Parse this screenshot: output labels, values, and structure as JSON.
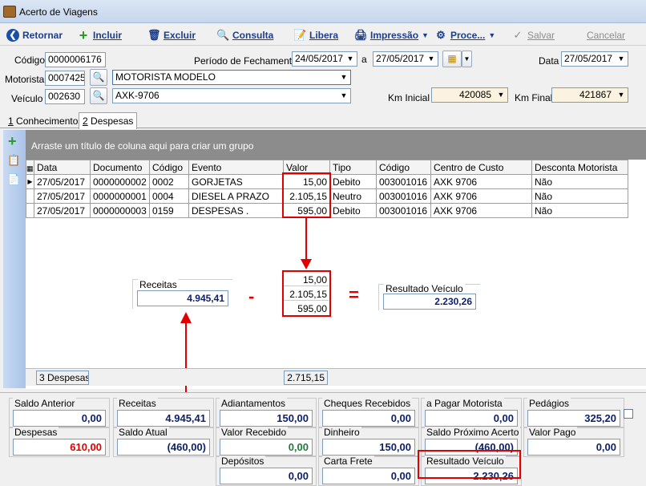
{
  "window": {
    "title": "Acerto de Viagens"
  },
  "toolbar": {
    "retornar": "Retornar",
    "incluir": "Incluir",
    "excluir": "Excluir",
    "consulta": "Consulta",
    "libera": "Libera",
    "impressao": "Impressão",
    "processos": "Proce...",
    "salvar": "Salvar",
    "cancelar": "Cancelar"
  },
  "header": {
    "codigo_label": "Código",
    "codigo": "0000006176",
    "periodo_label": "Período de Fechamento",
    "periodo_de": "24/05/2017",
    "a_label": "a",
    "periodo_ate": "27/05/2017",
    "data_label": "Data",
    "data": "27/05/2017",
    "motorista_label": "Motorista",
    "motorista_codigo": "0007425",
    "motorista_nome": "MOTORISTA MODELO",
    "veiculo_label": "Veículo",
    "veiculo_codigo": "002630",
    "veiculo_placa": "AXK-9706",
    "km_inicial_label": "Km Inicial",
    "km_inicial": "420085",
    "km_final_label": "Km Final",
    "km_final": "421867"
  },
  "tabs": [
    {
      "key": "1",
      "label": " Conhecimentos"
    },
    {
      "key": "2",
      "label": " Despesas"
    }
  ],
  "grid": {
    "group_hint": "Arraste um título de coluna aqui para criar um grupo",
    "columns": [
      "Data",
      "Documento",
      "Código",
      "Evento",
      "Valor",
      "Tipo",
      "Código",
      "Centro de Custo",
      "Desconta Motorista"
    ],
    "rows": [
      [
        "27/05/2017",
        "0000000002",
        "0002",
        "GORJETAS",
        "15,00",
        "Debito",
        "003001016",
        "AXK 9706",
        "Não"
      ],
      [
        "27/05/2017",
        "0000000001",
        "0004",
        "DIESEL A PRAZO",
        "2.105,15",
        "Neutro",
        "003001016",
        "AXK 9706",
        "Não"
      ],
      [
        "27/05/2017",
        "0000000003",
        "0159",
        "DESPESAS .",
        "595,00",
        "Debito",
        "003001016",
        "AXK 9706",
        "Não"
      ]
    ],
    "footer_count": "3 Despesas",
    "footer_total": "2.715,15"
  },
  "annotation": {
    "receitas_label": "Receitas",
    "receitas": "4.945,41",
    "minus": "-",
    "values": [
      "15,00",
      "2.105,15",
      "595,00"
    ],
    "equals": "=",
    "resultado_label": "Resultado Veículo",
    "resultado": "2.230,26"
  },
  "summary": {
    "saldo_anterior": {
      "label": "Saldo Anterior",
      "value": "0,00"
    },
    "receitas": {
      "label": "Receitas",
      "value": "4.945,41"
    },
    "adiantamentos": {
      "label": "Adiantamentos",
      "value": "150,00"
    },
    "cheques": {
      "label": "Cheques Recebidos",
      "value": "0,00"
    },
    "a_pagar": {
      "label": "a Pagar Motorista",
      "value": "0,00"
    },
    "pedagios": {
      "label": "Pedágios",
      "value": "325,20"
    },
    "despesas": {
      "label": "Despesas",
      "value": "610,00"
    },
    "saldo_atual": {
      "label": "Saldo Atual",
      "value": "(460,00)"
    },
    "valor_recebido": {
      "label": "Valor Recebido",
      "value": "0,00"
    },
    "dinheiro": {
      "label": "Dinheiro",
      "value": "150,00"
    },
    "saldo_proximo": {
      "label": "Saldo Próximo Acerto",
      "value": "(460,00)"
    },
    "valor_pago": {
      "label": "Valor Pago",
      "value": "0,00"
    },
    "depositos": {
      "label": "Depósitos",
      "value": "0,00"
    },
    "carta_frete": {
      "label": "Carta Frete",
      "value": "0,00"
    },
    "resultado_veiculo": {
      "label": "Resultado Veículo",
      "value": "2.230,26"
    }
  },
  "colors": {
    "red": "#e00000",
    "navy": "#0c1f6a",
    "green": "#1d7a3a"
  }
}
